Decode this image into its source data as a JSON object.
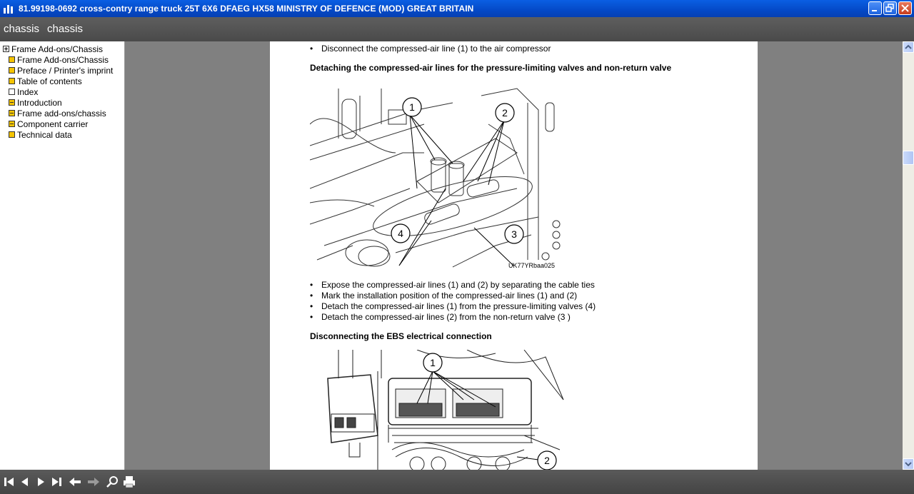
{
  "window": {
    "title": "81.99198-0692  cross-contry range truck 25T 6X6 DFAEG HX58 MINISTRY OF DEFENCE (MOD) GREAT BRITAIN"
  },
  "menubar": {
    "crumb1": "chassis",
    "crumb2": "chassis"
  },
  "tree": {
    "root": "Frame Add-ons/Chassis",
    "items": [
      {
        "label": "Frame Add-ons/Chassis",
        "icon": "book-icon"
      },
      {
        "label": "Preface / Printer's imprint",
        "icon": "book-icon"
      },
      {
        "label": "Table of contents",
        "icon": "book-icon"
      },
      {
        "label": "Index",
        "icon": "page-icon"
      },
      {
        "label": "Introduction",
        "icon": "book-expand-icon"
      },
      {
        "label": "Frame add-ons/chassis",
        "icon": "book-expand-icon"
      },
      {
        "label": "Component carrier",
        "icon": "book-expand-icon"
      },
      {
        "label": "Technical data",
        "icon": "book-icon"
      }
    ]
  },
  "document": {
    "line_top": "Disconnect the compressed-air line (1) to the air compressor",
    "heading1": "Detaching the compressed-air lines for the pressure-limiting valves and non-return valve",
    "fig1_code": "UK77YRbaa025",
    "fig1_callouts": [
      "1",
      "2",
      "3",
      "4"
    ],
    "steps": [
      "Expose the compressed-air lines (1) and (2) by separating the cable ties",
      "Mark the installation position of the compressed-air lines (1) and (2)",
      "Detach the compressed-air lines (1) from the pressure-limiting valves (4)",
      "Detach the compressed-air lines (2) from the non-return valve (3 )"
    ],
    "heading2": "Disconnecting the EBS electrical connection",
    "fig2_callouts": [
      "1",
      "2"
    ]
  },
  "colors": {
    "titlebar": "#0449c7",
    "toolbar": "#4a4a4a",
    "background": "#808080",
    "tree_icon": "#f5c400"
  }
}
